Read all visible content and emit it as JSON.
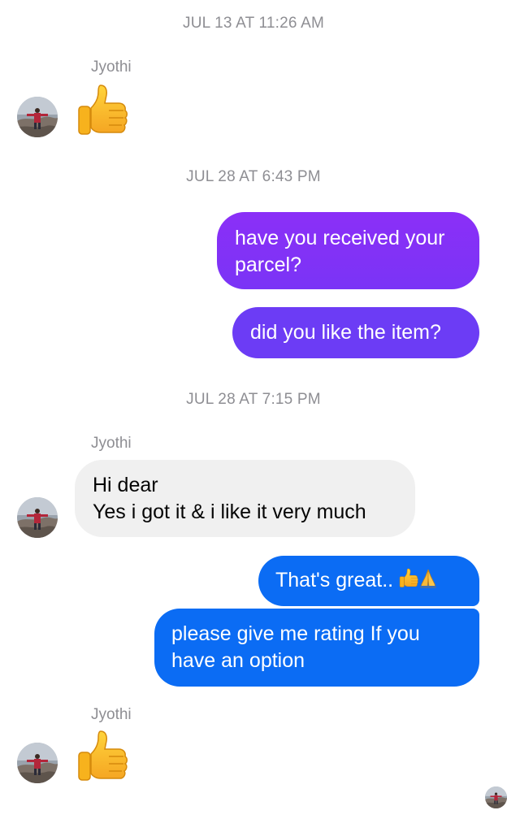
{
  "conversation": {
    "timestamps": [
      "JUL 13 AT 11:26 AM",
      "JUL 28 AT 6:43 PM",
      "JUL 28 AT 7:15 PM"
    ],
    "contact_name": "Jyothi",
    "messages": {
      "sent_1_line1": "have you received your",
      "sent_1_line2": "parcel?",
      "sent_2": "did you like the item?",
      "recv_1_line1": "Hi dear",
      "recv_1_line2": "Yes i got it & i like it very much",
      "sent_3_text": "That's great..",
      "sent_4_line1": "please give me rating If you",
      "sent_4_line2": "have an option"
    }
  },
  "colors": {
    "outgoing_purple": "#7b2ff7",
    "outgoing_violet": "#6a3cf5",
    "outgoing_blue": "#0a6cf5",
    "incoming_gray": "#f0f0f0",
    "timestamp_gray": "#8e8e93"
  },
  "icons": {
    "reaction": "thumbs-up-icon",
    "inline": [
      "thumbs-up-icon",
      "folded-hands-icon"
    ]
  }
}
